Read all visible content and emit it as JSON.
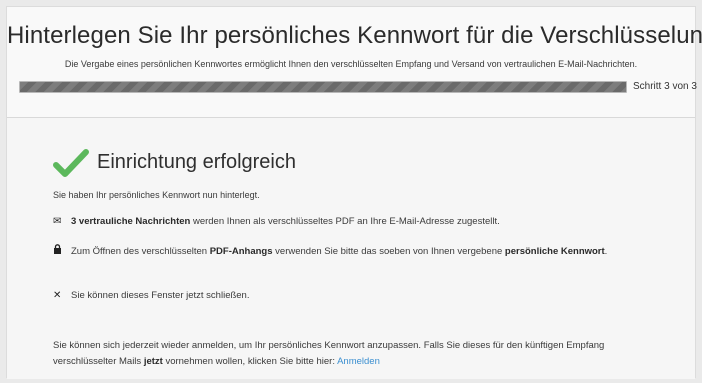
{
  "header": {
    "title": "Hinterlegen Sie Ihr persönliches Kennwort für die Verschlüsselung",
    "subtitle": "Die Vergabe eines persönlichen Kennwortes ermöglicht Ihnen den verschlüsselten Empfang und Versand von vertraulichen E-Mail-Nachrichten.",
    "progress": {
      "current_step": 3,
      "total_steps": 3,
      "fraction": 1.0,
      "label": "Schritt 3 von 3"
    }
  },
  "success": {
    "icon": "check-icon",
    "title": "Einrichtung erfolgreich",
    "text": "Sie haben Ihr persönliches Kennwort nun hinterlegt."
  },
  "items": [
    {
      "icon": "envelope-icon",
      "bold1": "3 vertrauliche Nachrichten",
      "text1": " werden Ihnen als verschlüsseltes PDF an Ihre E-Mail-Adresse zugestellt."
    },
    {
      "icon": "lock-icon",
      "text1": "Zum Öffnen des verschlüsselten ",
      "bold1": "PDF-Anhangs",
      "text2": " verwenden Sie bitte das soeben von Ihnen vergebene ",
      "bold2": "persönliche Kennwort",
      "text3": "."
    },
    {
      "icon": "close-icon",
      "text1": "Sie können dieses Fenster jetzt schließen."
    }
  ],
  "footer": {
    "text1": "Sie können sich jederzeit wieder anmelden, um Ihr persönliches Kennwort anzupassen. Falls Sie dieses für den künftigen Empfang verschlüsselter Mails ",
    "bold": "jetzt",
    "text2": " vornehmen wollen, klicken Sie bitte hier: ",
    "link": "Anmelden"
  },
  "colors": {
    "accent_link": "#3b8fd0",
    "check_green": "#4caf50",
    "progress_fill": "#767676"
  }
}
